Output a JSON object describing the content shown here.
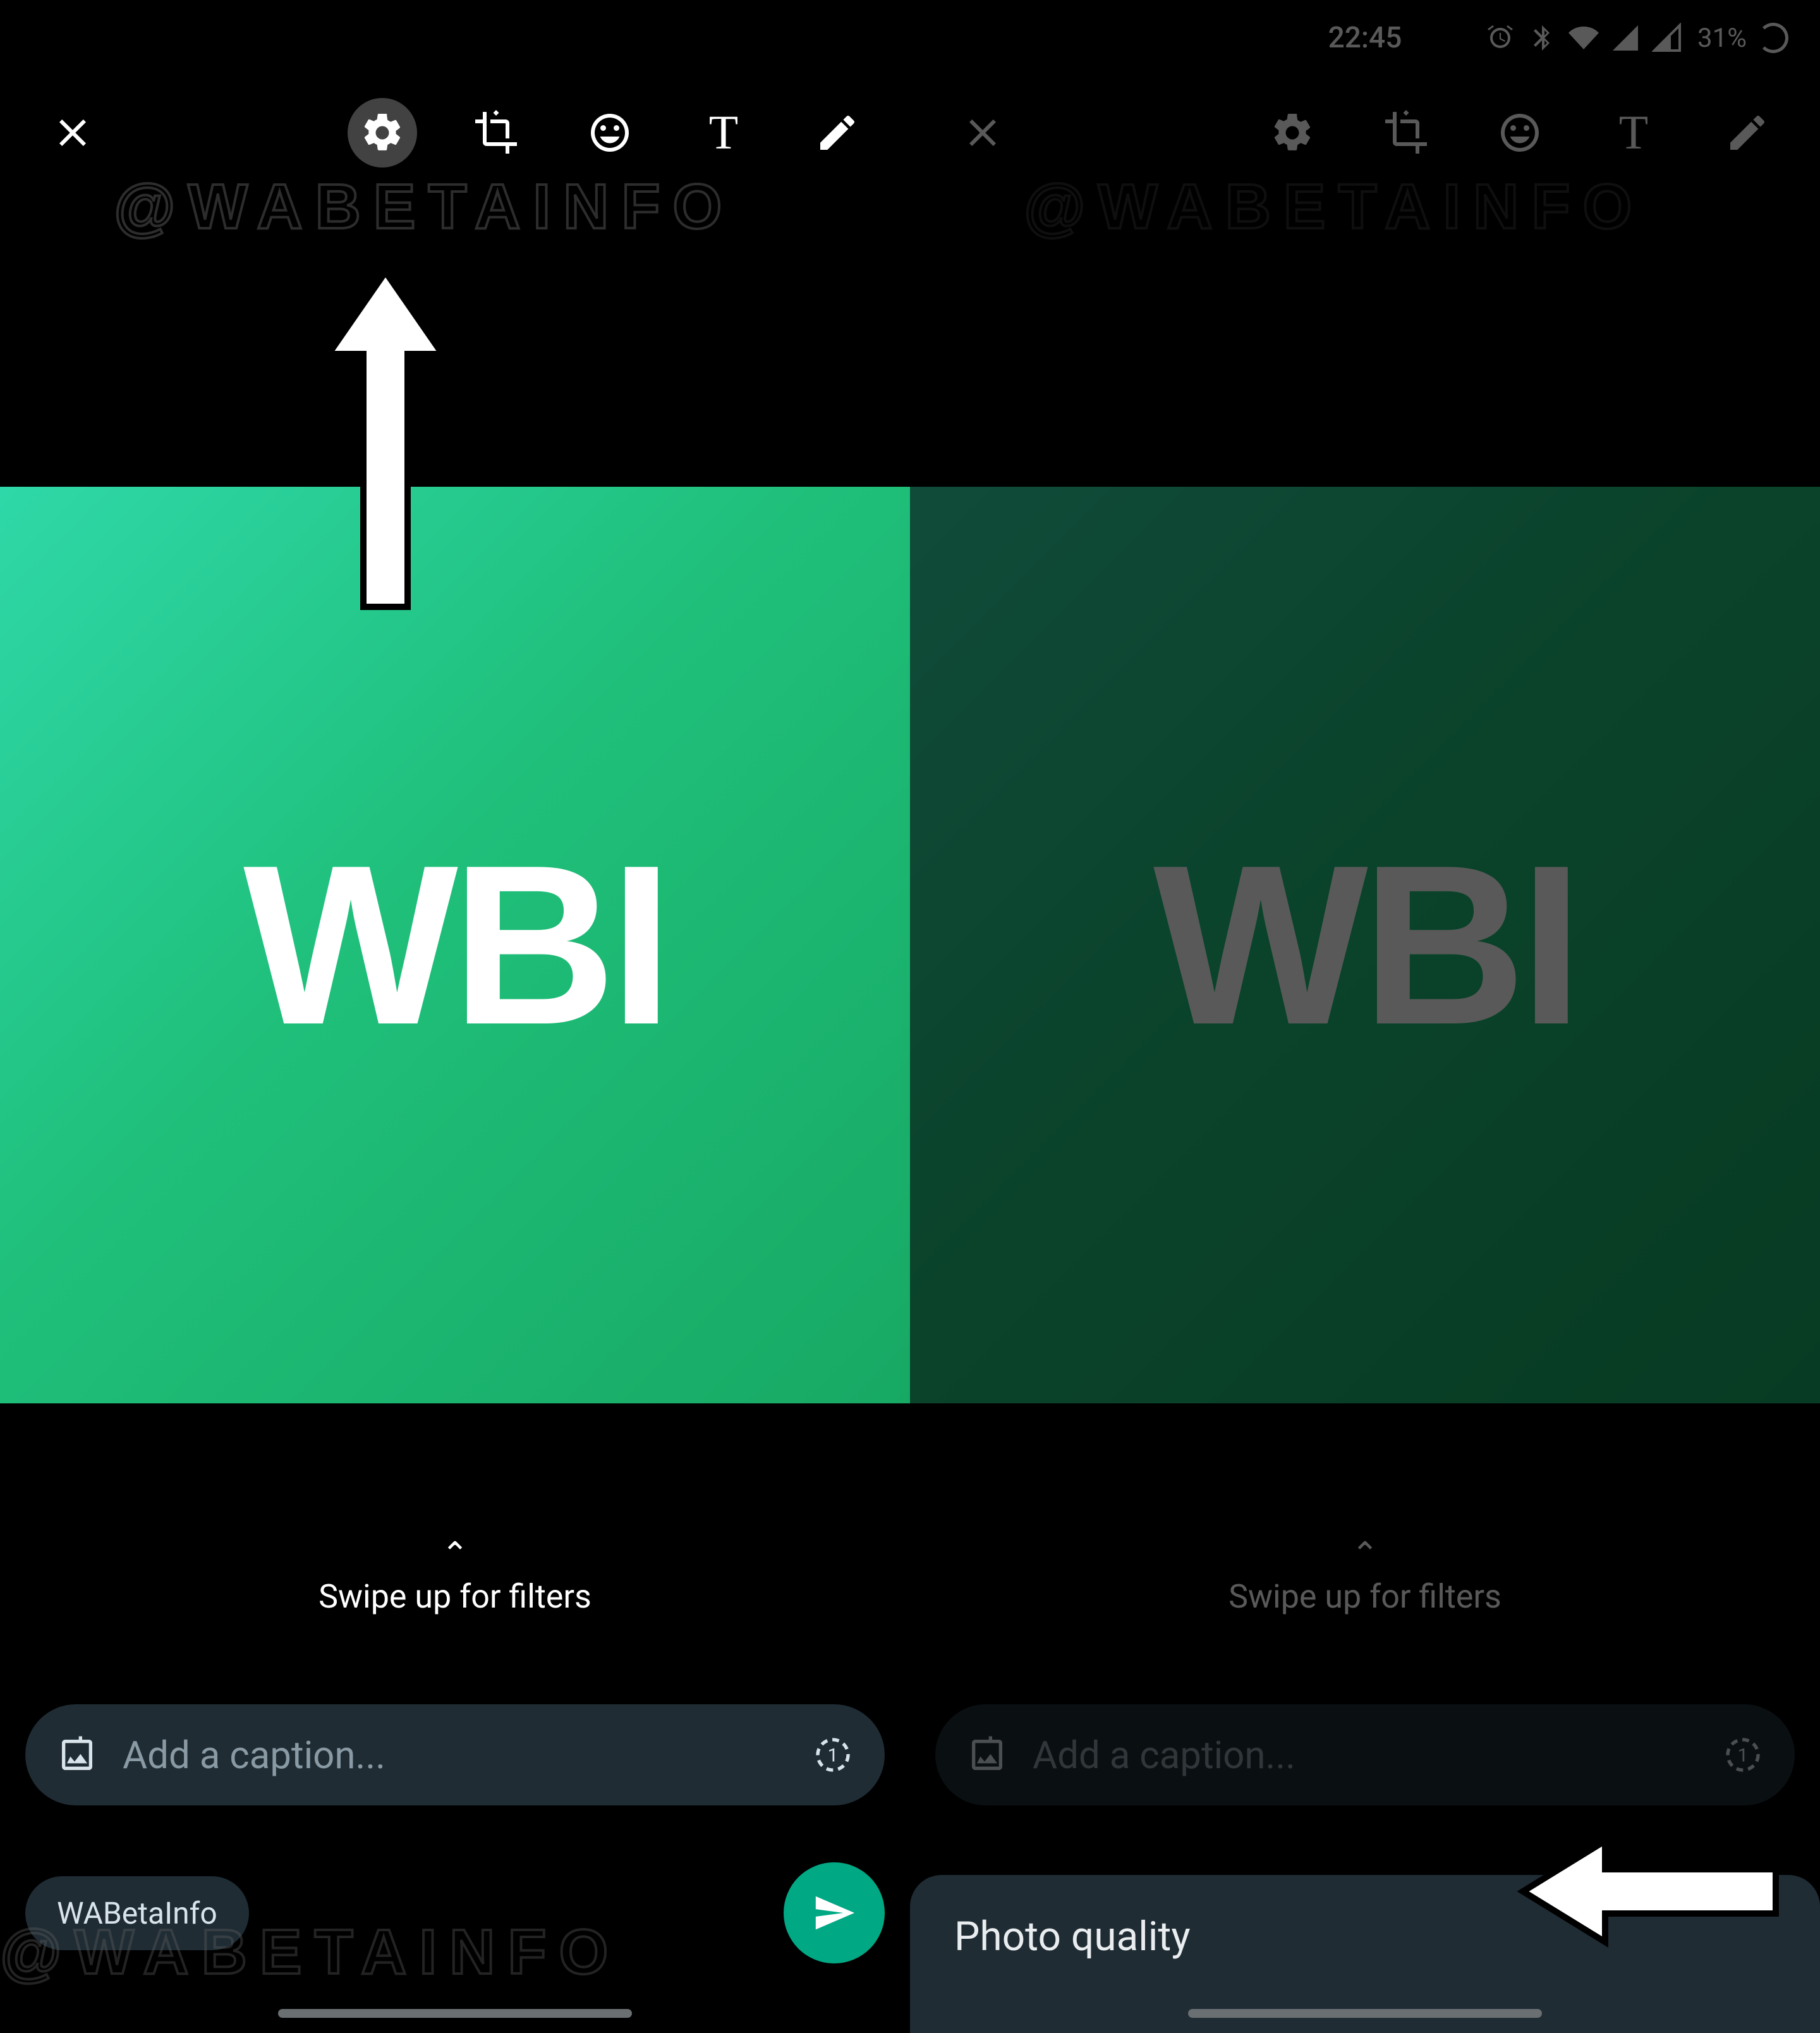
{
  "status": {
    "time": "22:45",
    "battery": "31%"
  },
  "watermark": "@WABETAINFO",
  "canvas": {
    "logo_text": "WBI"
  },
  "filters_hint": "Swipe up for filters",
  "caption": {
    "placeholder": "Add a caption..."
  },
  "recipient": "WABetaInfo",
  "sheet": {
    "title": "Photo quality"
  },
  "icons": {
    "close": "close-icon",
    "settings": "gear-icon",
    "crop": "crop-rotate-icon",
    "emoji": "emoji-icon",
    "text": "text-icon",
    "draw": "pencil-icon",
    "add_image": "add-image-icon",
    "view_once": "view-once-icon",
    "send": "send-icon",
    "alarm": "alarm-icon",
    "bluetooth": "bluetooth-icon",
    "wifi": "wifi-icon",
    "signal1": "signal-icon",
    "signal2": "signal-icon",
    "loading": "loading-spinner-icon"
  }
}
